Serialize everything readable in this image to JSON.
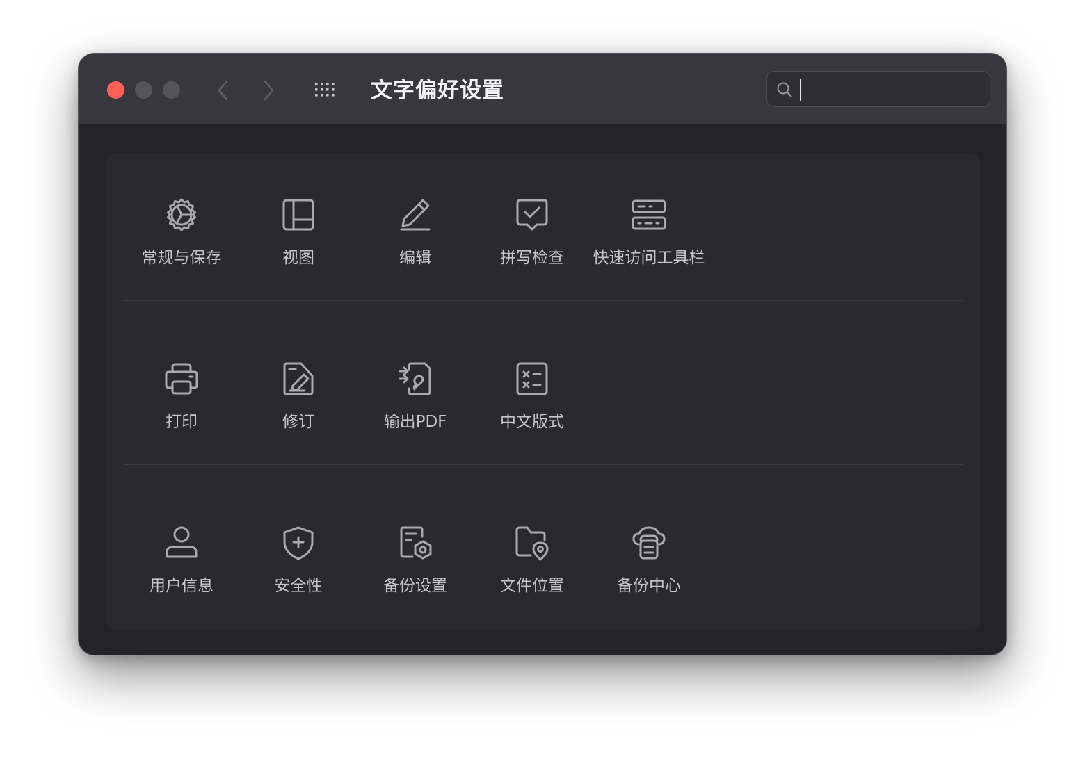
{
  "window": {
    "title": "文字偏好设置"
  },
  "search": {
    "value": "",
    "placeholder": ""
  },
  "sections": [
    {
      "items": [
        {
          "label": "常规与保存",
          "icon": "gear-icon"
        },
        {
          "label": "视图",
          "icon": "layout-icon"
        },
        {
          "label": "编辑",
          "icon": "pencil-icon"
        },
        {
          "label": "拼写检查",
          "icon": "spellcheck-icon"
        },
        {
          "label": "快速访问工具栏",
          "icon": "toolbar-icon"
        }
      ]
    },
    {
      "items": [
        {
          "label": "打印",
          "icon": "printer-icon"
        },
        {
          "label": "修订",
          "icon": "revision-icon"
        },
        {
          "label": "输出PDF",
          "icon": "pdf-export-icon"
        },
        {
          "label": "中文版式",
          "icon": "chinese-layout-icon"
        }
      ]
    },
    {
      "items": [
        {
          "label": "用户信息",
          "icon": "user-icon"
        },
        {
          "label": "安全性",
          "icon": "shield-icon"
        },
        {
          "label": "备份设置",
          "icon": "backup-settings-icon"
        },
        {
          "label": "文件位置",
          "icon": "folder-location-icon"
        },
        {
          "label": "备份中心",
          "icon": "backup-center-icon"
        }
      ]
    }
  ],
  "colors": {
    "window_bg": "#242328",
    "titlebar_bg": "#38373d",
    "panel_bg": "#2a292e",
    "icon_stroke": "#a9a9ae",
    "label_text": "#c5c5ca",
    "title_text": "#f4f4f6",
    "close_button": "#fe5f57",
    "inactive_button": "#55545a"
  }
}
